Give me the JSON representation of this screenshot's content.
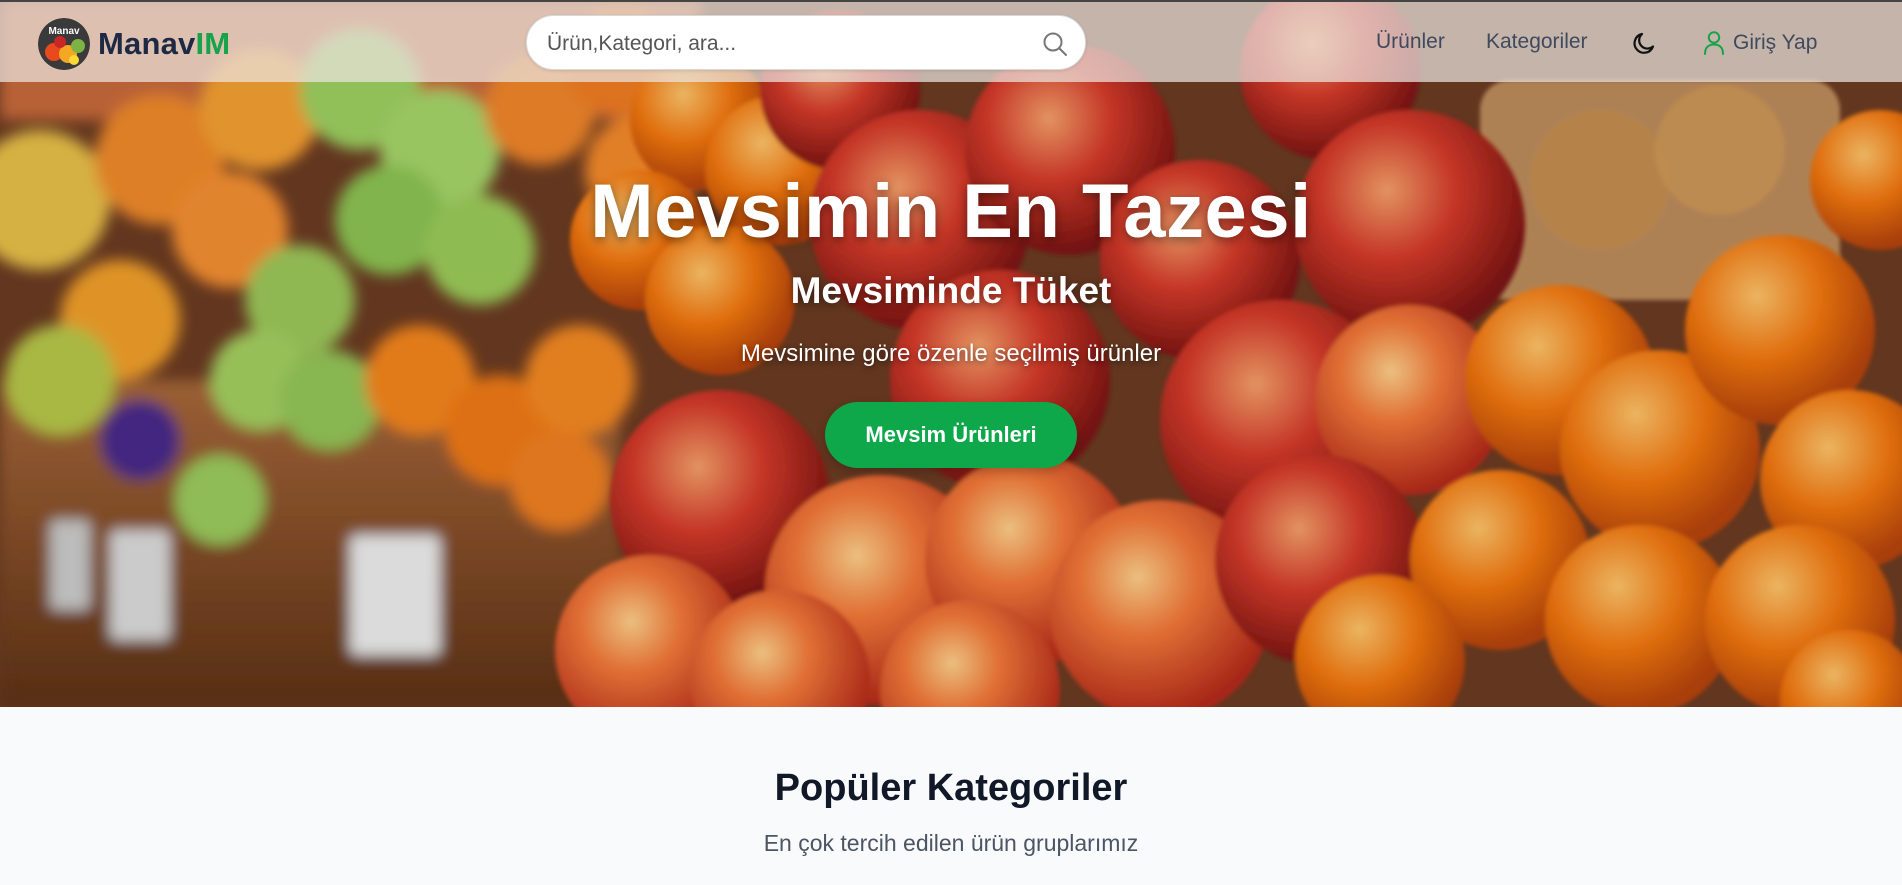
{
  "navbar": {
    "brand_part1": "Manav",
    "brand_part2": "IM",
    "logo_text": "Manav",
    "search_placeholder": "Ürün,Kategori, ara...",
    "links": [
      {
        "label": "Ürünler"
      },
      {
        "label": "Kategoriler"
      }
    ],
    "theme_icon": "moon-icon",
    "login": {
      "label": "Giriş Yap",
      "icon": "user-icon"
    }
  },
  "hero": {
    "title": "Mevsimin En Tazesi",
    "subtitle": "Mevsiminde Tüket",
    "description": "Mevsimine göre özenle seçilmiş ürünler",
    "button_label": "Mevsim Ürünleri"
  },
  "categories_section": {
    "title": "Popüler Kategoriler",
    "subtitle": "En çok tercih edilen ürün gruplarımız"
  },
  "colors": {
    "accent_green": "#16a34a",
    "button_green": "#0ea84a",
    "brand_dark": "#1e2a44",
    "nav_text": "#3f4a5e"
  }
}
